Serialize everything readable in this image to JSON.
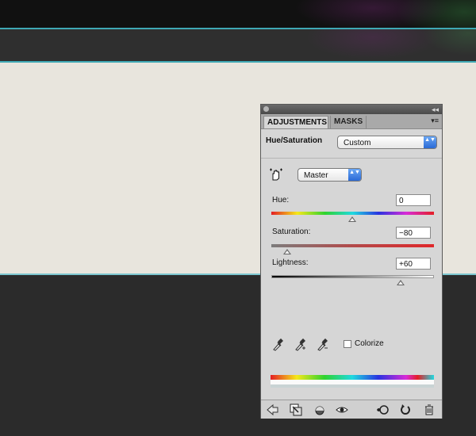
{
  "panel": {
    "tabs": [
      "ADJUSTMENTS",
      "MASKS"
    ],
    "title": "Hue/Saturation",
    "preset": "Custom",
    "channel": "Master",
    "hue": {
      "label": "Hue:",
      "value": "0"
    },
    "saturation": {
      "label": "Saturation:",
      "value": "−80"
    },
    "lightness": {
      "label": "Lightness:",
      "value": "+60"
    },
    "colorize": {
      "label": "Colorize",
      "checked": false
    },
    "collapse_glyph": "◂◂",
    "menu_glyph": "▾≡",
    "select_arrows": "▲▼"
  },
  "icons": {
    "panel_close": "close-icon",
    "panel_collapse": "collapse-icon",
    "panel_menu": "menu-icon",
    "hand_tool": "targeted-adjustment-hand-icon",
    "droppers": [
      "eyedropper-icon",
      "eyedropper-plus-icon",
      "eyedropper-minus-icon"
    ],
    "bottom": [
      "back-arrow-icon",
      "clip-layer-icon",
      "visibility-circle-icon",
      "eye-icon",
      "previous-state-icon",
      "reset-icon",
      "trash-icon"
    ]
  },
  "colors": {
    "accent_select": "#2a6ad6",
    "guide_line": "#3fa9b5"
  }
}
